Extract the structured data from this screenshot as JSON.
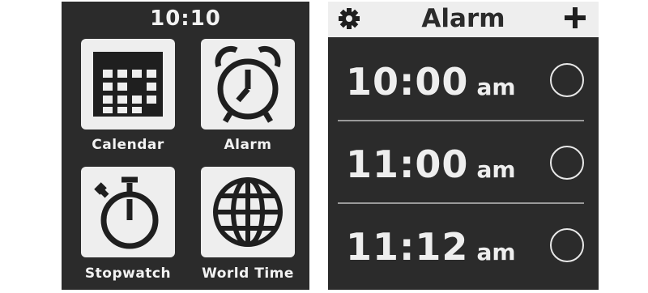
{
  "home": {
    "time": "10:10",
    "apps": [
      {
        "label": "Calendar",
        "icon": "calendar-icon"
      },
      {
        "label": "Alarm",
        "icon": "alarm-clock-icon"
      },
      {
        "label": "Stopwatch",
        "icon": "stopwatch-icon"
      },
      {
        "label": "World Time",
        "icon": "globe-icon"
      }
    ]
  },
  "alarm": {
    "title": "Alarm",
    "settings_icon": "gear-icon",
    "add_icon": "plus-icon",
    "alarms": [
      {
        "time": "10:00",
        "period": "am",
        "enabled": false
      },
      {
        "time": "11:00",
        "period": "am",
        "enabled": false
      },
      {
        "time": "11:12",
        "period": "am",
        "enabled": false
      }
    ]
  },
  "colors": {
    "screen": "#2b2b2b",
    "foreground": "#eeeeee"
  }
}
